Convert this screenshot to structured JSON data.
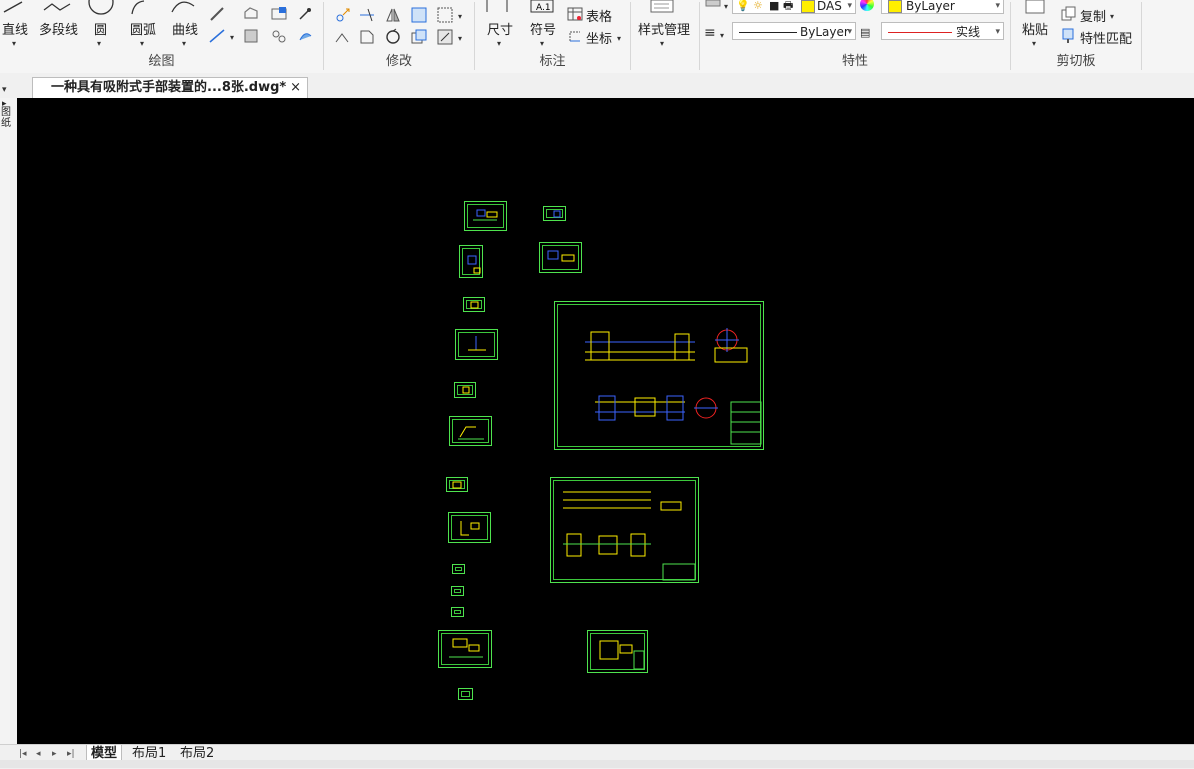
{
  "ribbon": {
    "draw_group": {
      "label": "绘图",
      "tools": [
        "直线",
        "多段线",
        "圆",
        "圆弧",
        "曲线"
      ]
    },
    "modify_group": {
      "label": "修改"
    },
    "annotate_group": {
      "label": "标注",
      "tools": [
        "尺寸",
        "符号",
        "表格",
        "坐标"
      ]
    },
    "style_group": {
      "tool": "样式管理"
    },
    "properties_group": {
      "label": "特性",
      "layer_value": "DAS",
      "color_value": "ByLayer",
      "linetype_value": "ByLayer",
      "lineweight_value": "实线"
    },
    "clipboard_group": {
      "label": "剪切板",
      "paste": "粘贴",
      "copy": "复制",
      "match_properties": "特性匹配"
    }
  },
  "document_tab": {
    "title": "一种具有吸附式手部装置的...8张.dwg*",
    "close": "×"
  },
  "left_strip_text": "图纸",
  "layout_tabs": {
    "items": [
      "模型",
      "布局1",
      "布局2"
    ],
    "active": "模型"
  },
  "icons": [
    "line-icon",
    "polyline-icon",
    "circle-icon",
    "arc-icon",
    "curve-icon",
    "move-icon",
    "mirror-icon",
    "array-icon",
    "rotate-icon",
    "copy-icon",
    "match-properties-icon",
    "paste-icon",
    "layer-icon",
    "color-icon",
    "table-icon",
    "close-icon"
  ],
  "colors": {
    "canvas": "#000000",
    "sheet_border": "#4ee34e",
    "accent": "#2a6fdb"
  }
}
